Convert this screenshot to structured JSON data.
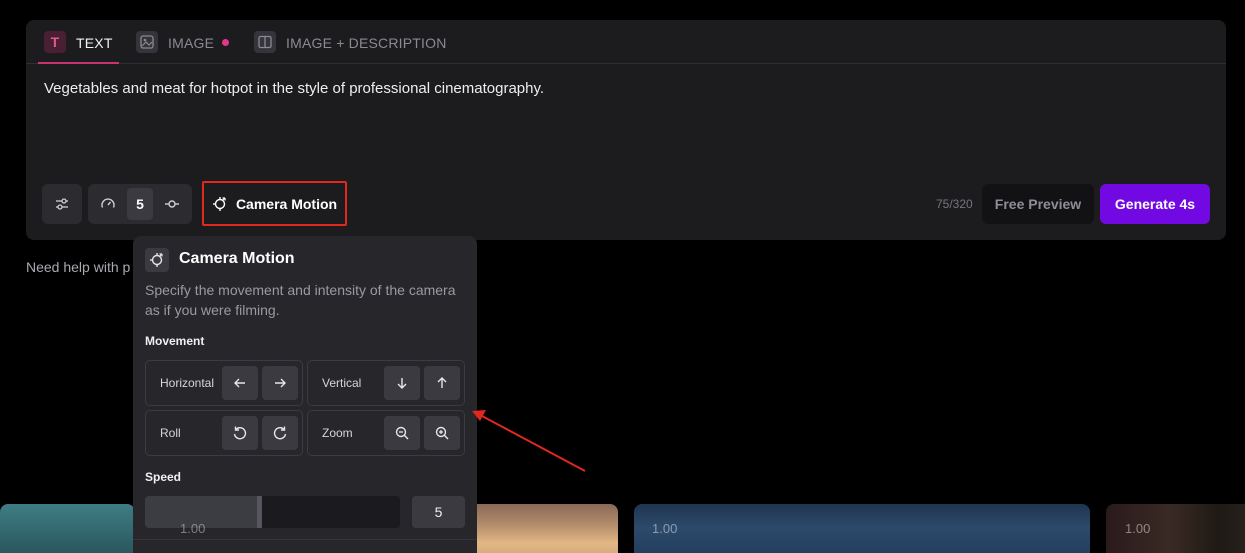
{
  "tabs": [
    {
      "label": "TEXT",
      "icon": "text-icon",
      "active": true
    },
    {
      "label": "IMAGE",
      "icon": "image-icon",
      "active": false
    },
    {
      "label": "IMAGE + DESCRIPTION",
      "icon": "image-description-icon",
      "active": false
    }
  ],
  "prompt": {
    "text": "Vegetables and meat for hotpot in the style of professional cinematography."
  },
  "toolbar": {
    "duration_value": "5",
    "camera_motion_label": "Camera Motion",
    "char_counter": "75/320",
    "free_preview_label": "Free Preview",
    "generate_label": "Generate 4s"
  },
  "help_text": "Need help with p",
  "camera_popover": {
    "title": "Camera Motion",
    "description": "Specify the movement and intensity of the camera as if you were filming.",
    "movement_label": "Movement",
    "controls": {
      "horizontal": "Horizontal",
      "vertical": "Vertical",
      "roll": "Roll",
      "zoom": "Zoom"
    },
    "speed_label": "Speed",
    "speed_value": "5",
    "speed_fraction": 0.45
  },
  "thumbnails": [
    {
      "label": "1.00"
    },
    {
      "label": ""
    },
    {
      "label": "1.00"
    },
    {
      "label": "1.00"
    }
  ],
  "colors": {
    "accent_purple": "#7209e3",
    "tab_pink": "#c7346f",
    "highlight_red": "#e0281c"
  }
}
